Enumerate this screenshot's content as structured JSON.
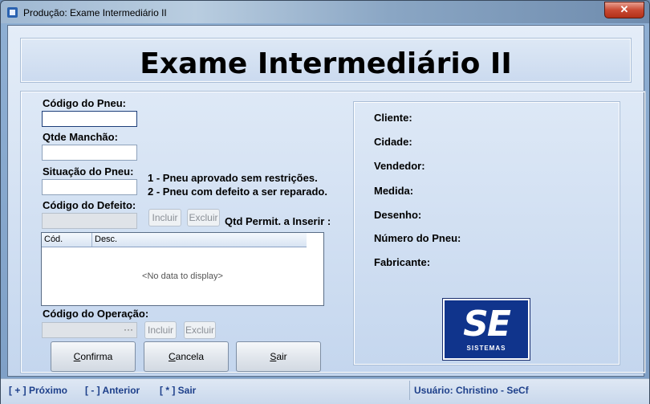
{
  "window": {
    "title": "Produção: Exame Intermediário II",
    "close": "✕"
  },
  "header": {
    "title": "Exame Intermediário II"
  },
  "form": {
    "codigo_pneu_label": "Código do Pneu:",
    "codigo_pneu_value": "",
    "qtde_manchao_label": "Qtde Manchão:",
    "qtde_manchao_value": "",
    "situacao_label": "Situação do Pneu:",
    "situacao_value": "",
    "situacao_option_1": "1 - Pneu aprovado sem restrições.",
    "situacao_option_2": "2 - Pneu com defeito a ser reparado.",
    "codigo_defeito_label": "Código do Defeito:",
    "codigo_defeito_value": "",
    "incluir_label": "Incluir",
    "excluir_label": "Excluir",
    "qtd_permit_label": "Qtd Permit. a Inserir :",
    "grid": {
      "columns": [
        "Cód.",
        "Desc."
      ],
      "empty_text": "<No data to display>"
    },
    "codigo_operacao_label": "Código do Operação:",
    "codigo_operacao_value": "",
    "codigo_operacao_ellipsis": "···"
  },
  "buttons": {
    "confirma_underline": "C",
    "confirma_rest": "onfirma",
    "cancela_underline": "C",
    "cancela_rest": "ancela",
    "sair_underline": "S",
    "sair_rest": "air"
  },
  "info": {
    "cliente": "Cliente:",
    "cidade": "Cidade:",
    "vendedor": "Vendedor:",
    "medida": "Medida:",
    "desenho": "Desenho:",
    "numero_pneu": "Número do Pneu:",
    "fabricante": "Fabricante:"
  },
  "logo": {
    "text": "SE",
    "subtitle": "SISTEMAS"
  },
  "statusbar": {
    "proximo": "[ + ] Próximo",
    "anterior": "[ - ] Anterior",
    "sair": "[ * ] Sair",
    "usuario": "Usuário: Christino - SeCf"
  }
}
